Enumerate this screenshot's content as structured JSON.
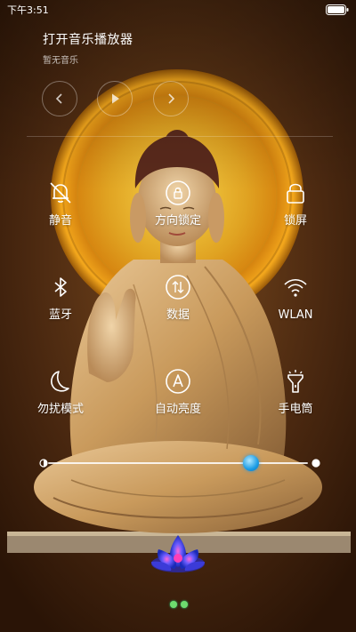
{
  "status_bar": {
    "time": "下午3:51"
  },
  "music": {
    "title": "打开音乐播放器",
    "subtitle": "暂无音乐"
  },
  "media_controls": [
    {
      "icon": "previous-icon"
    },
    {
      "icon": "play-icon"
    },
    {
      "icon": "next-icon"
    }
  ],
  "toggles": [
    {
      "label": "静音",
      "icon": "bell-mute-icon"
    },
    {
      "label": "方向锁定",
      "icon": "rotation-lock-icon"
    },
    {
      "label": "锁屏",
      "icon": "lock-icon"
    },
    {
      "label": "蓝牙",
      "icon": "bluetooth-icon"
    },
    {
      "label": "数据",
      "icon": "data-icon"
    },
    {
      "label": "WLAN",
      "icon": "wifi-icon"
    },
    {
      "label": "勿扰模式",
      "icon": "moon-icon"
    },
    {
      "label": "自动亮度",
      "icon": "auto-brightness-icon"
    },
    {
      "label": "手电筒",
      "icon": "flashlight-icon"
    }
  ],
  "brightness": {
    "level": 0.78
  },
  "page_indicator": {
    "count": 2
  },
  "colors": {
    "accent": "#1b9ce5",
    "indicator": "#6edb6e"
  }
}
